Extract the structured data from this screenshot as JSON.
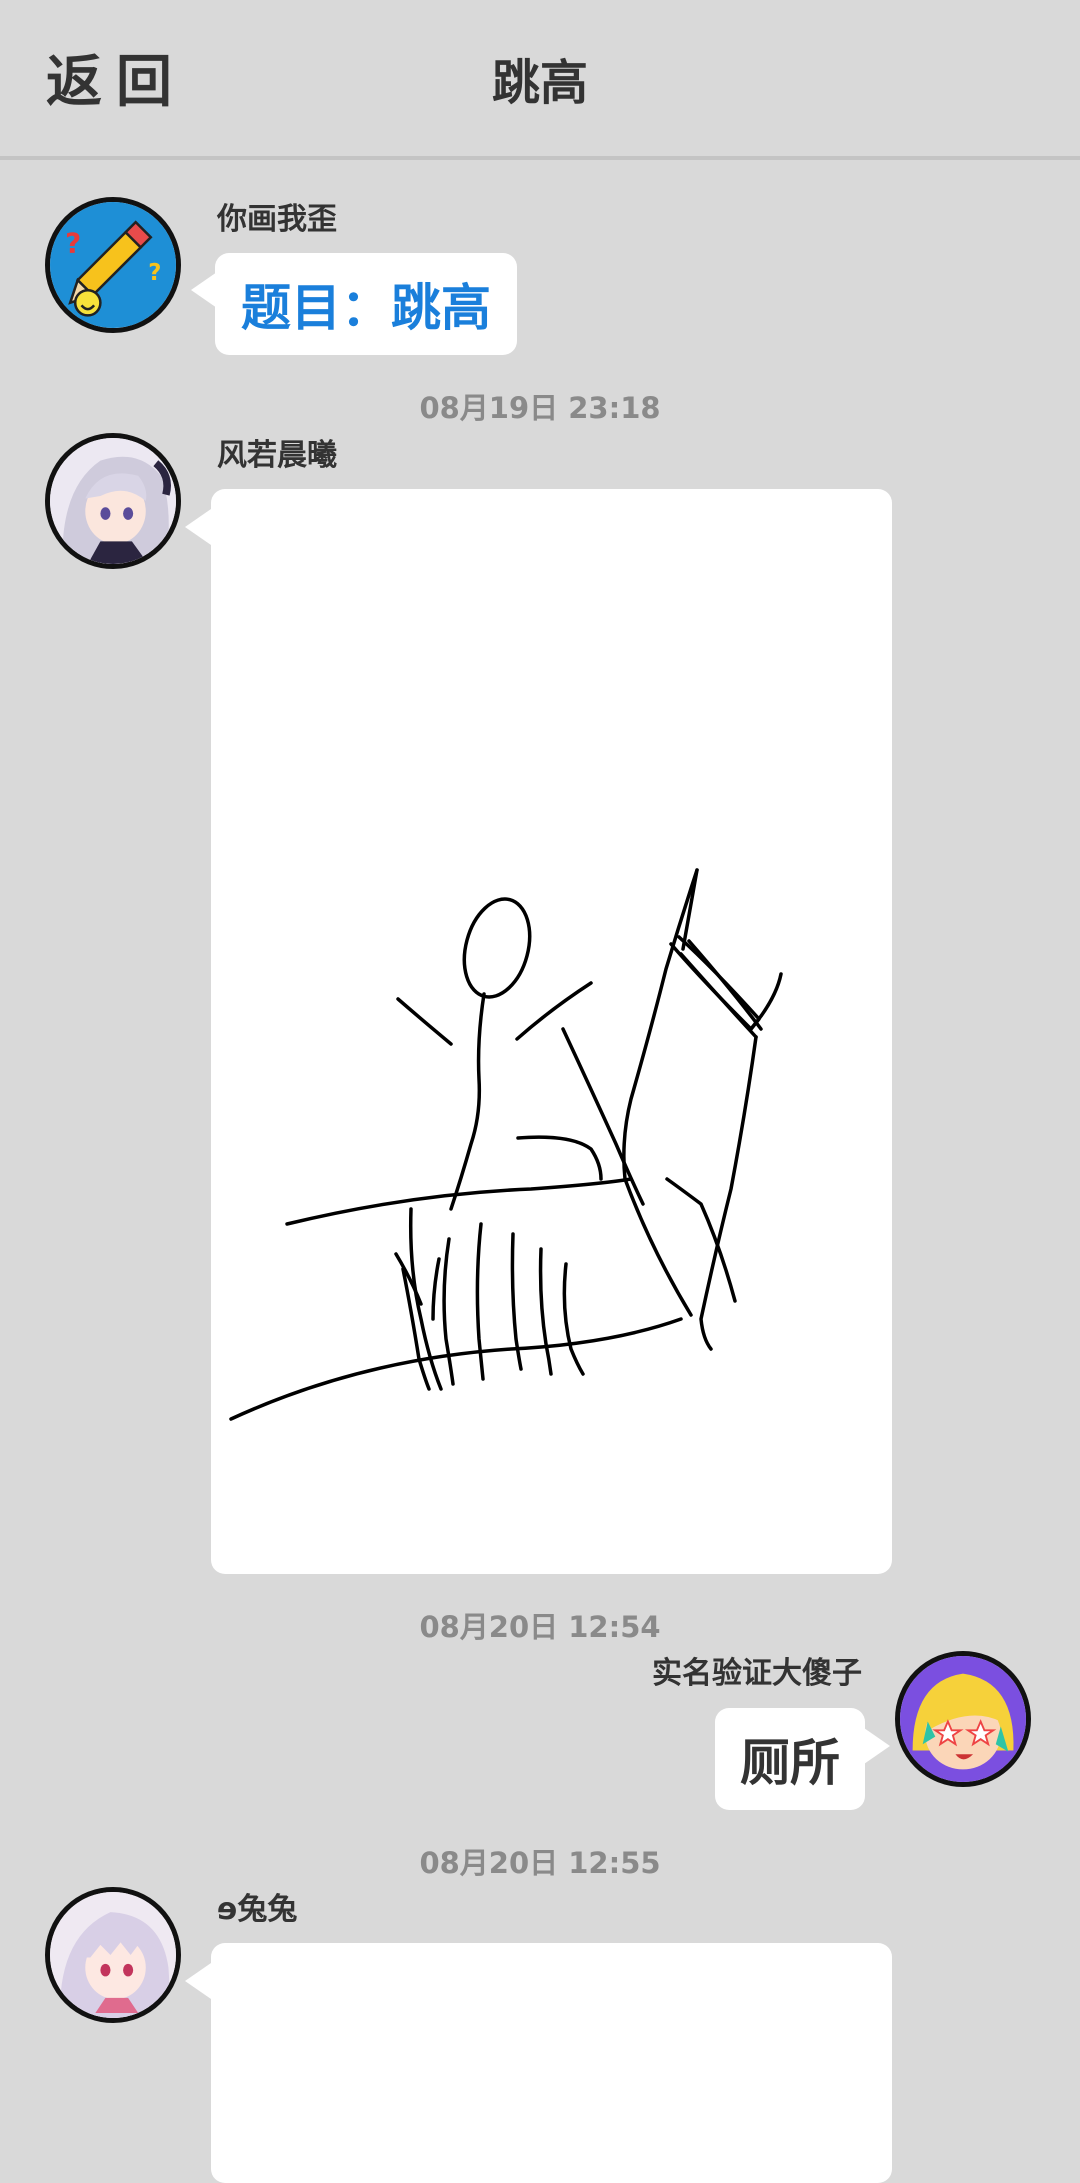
{
  "header": {
    "back_label": "返回",
    "title": "跳高"
  },
  "messages": [
    {
      "sender": "你画我歪",
      "text": "题目：跳高",
      "text_color": "#1a7fdb",
      "avatar_icon": "pencil-game-logo-icon"
    },
    {
      "timestamp": "08月19日  23:18",
      "sender": "风若晨曦",
      "content": "drawing",
      "drawing_description_icon": "stick-figure-high-jump-drawing",
      "avatar_icon": "anime-girl-silver-hair-avatar"
    },
    {
      "timestamp": "08月20日  12:54",
      "sender": "实名验证大傻子",
      "text": "厕所",
      "avatar_icon": "star-eyes-cartoon-avatar"
    },
    {
      "timestamp": "08月20日  12:55",
      "sender": "ɘ兔兔",
      "content": "drawing",
      "avatar_icon": "anime-girl-lavender-hair-avatar"
    }
  ],
  "colors": {
    "background": "#d9d9d9",
    "bubble": "#ffffff",
    "accent_blue": "#1a7fdb",
    "timestamp": "#8a8a8a"
  }
}
